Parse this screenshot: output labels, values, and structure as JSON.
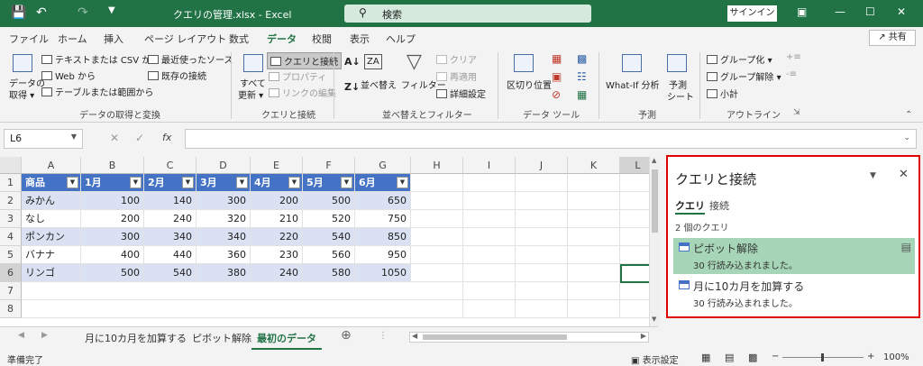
{
  "window": {
    "file_name": "クエリの管理.xlsx  -  Excel",
    "search_placeholder": "検索",
    "signin_label": "サインイン"
  },
  "menu": {
    "tabs": [
      "ファイル",
      "ホーム",
      "挿入",
      "ページ レイアウト",
      "数式",
      "データ",
      "校閲",
      "表示",
      "ヘルプ"
    ],
    "active": "データ",
    "share_label": "共有"
  },
  "ribbon": {
    "get_data": "データの\n取得",
    "get_data_l1": "データの",
    "get_data_l2": "取得 ▾",
    "from_text_csv": "テキストまたは CSV から",
    "from_web": "Web から",
    "from_table": "テーブルまたは範囲から",
    "recent_sources": "最近使ったソース",
    "existing_connections": "既存の接続",
    "group1": "データの取得と変換",
    "refresh_all_l1": "すべて",
    "refresh_all_l2": "更新 ▾",
    "queries_connections": "クエリと接続",
    "properties": "プロパティ",
    "edit_links": "リンクの編集",
    "group2": "クエリと接続",
    "sort": "並べ替え",
    "filter": "フィルター",
    "clear": "クリア",
    "reapply": "再適用",
    "advanced": "詳細設定",
    "group3": "並べ替えとフィルター",
    "text_to_columns": "区切り位置",
    "group4": "データ ツール",
    "whatif": "What-If 分析",
    "forecast_l1": "予測",
    "forecast_l2": "シート",
    "group5": "予測",
    "group_btn": "グループ化",
    "ungroup_btn": "グループ解除",
    "subtotal": "小計",
    "group6": "アウトライン"
  },
  "formula_bar": {
    "cell_ref": "L6",
    "fx": "fx",
    "value": ""
  },
  "sheet": {
    "columns": [
      "A",
      "B",
      "C",
      "D",
      "E",
      "F",
      "G",
      "H",
      "I",
      "J",
      "K",
      "L"
    ],
    "header_row": [
      "商品",
      "1月",
      "2月",
      "3月",
      "4月",
      "5月",
      "6月"
    ],
    "rows": [
      [
        "みかん",
        "100",
        "140",
        "300",
        "200",
        "500",
        "650"
      ],
      [
        "なし",
        "200",
        "240",
        "320",
        "210",
        "520",
        "750"
      ],
      [
        "ポンカン",
        "300",
        "340",
        "340",
        "220",
        "540",
        "850"
      ],
      [
        "バナナ",
        "400",
        "440",
        "360",
        "230",
        "560",
        "950"
      ],
      [
        "リンゴ",
        "500",
        "540",
        "380",
        "240",
        "580",
        "1050"
      ]
    ],
    "row_numbers": [
      "1",
      "2",
      "3",
      "4",
      "5",
      "6",
      "7",
      "8"
    ]
  },
  "sheet_tabs": [
    "月に10カ月を加算する",
    "ピボット解除",
    "最初のデータ"
  ],
  "active_sheet": "最初のデータ",
  "status": {
    "ready": "準備完了",
    "display_settings": "表示設定",
    "zoom": "100%"
  },
  "pane": {
    "title": "クエリと接続",
    "tab_queries": "クエリ",
    "tab_connections": "接続",
    "count": "2 個のクエリ",
    "queries": [
      {
        "name": "ピボット解除",
        "rows": "30 行読み込まれました。"
      },
      {
        "name": "月に10カ月を加算する",
        "rows": "30 行読み込まれました。"
      }
    ],
    "highlight_color": "#a6d6b7",
    "border_color": "#e00000"
  }
}
